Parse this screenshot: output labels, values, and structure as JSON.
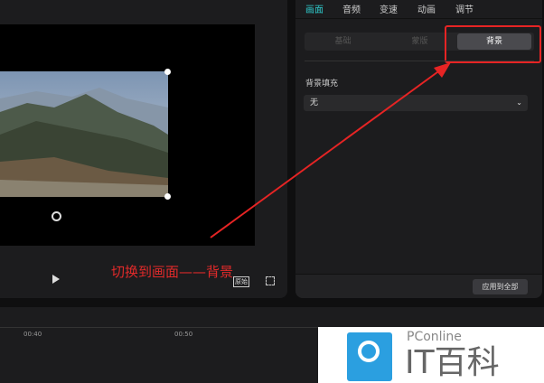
{
  "tabs": [
    {
      "label": "画面",
      "active": true
    },
    {
      "label": "音频"
    },
    {
      "label": "变速"
    },
    {
      "label": "动画"
    },
    {
      "label": "调节"
    }
  ],
  "segments": [
    {
      "label": "基础"
    },
    {
      "label": "蒙版"
    },
    {
      "label": "背景",
      "active": true
    }
  ],
  "background_fill": {
    "label": "背景填充",
    "value": "无"
  },
  "apply_all": "应用到全部",
  "player": {
    "ratio_label": "原始"
  },
  "timeline": {
    "ticks": [
      "00:40",
      "00:50"
    ]
  },
  "annotation": "切换到画面——背景",
  "watermark": {
    "brand": "PConline",
    "name": "IT百科"
  },
  "colors": {
    "accent": "#2ec7c9",
    "annotation": "#e02a2a"
  }
}
